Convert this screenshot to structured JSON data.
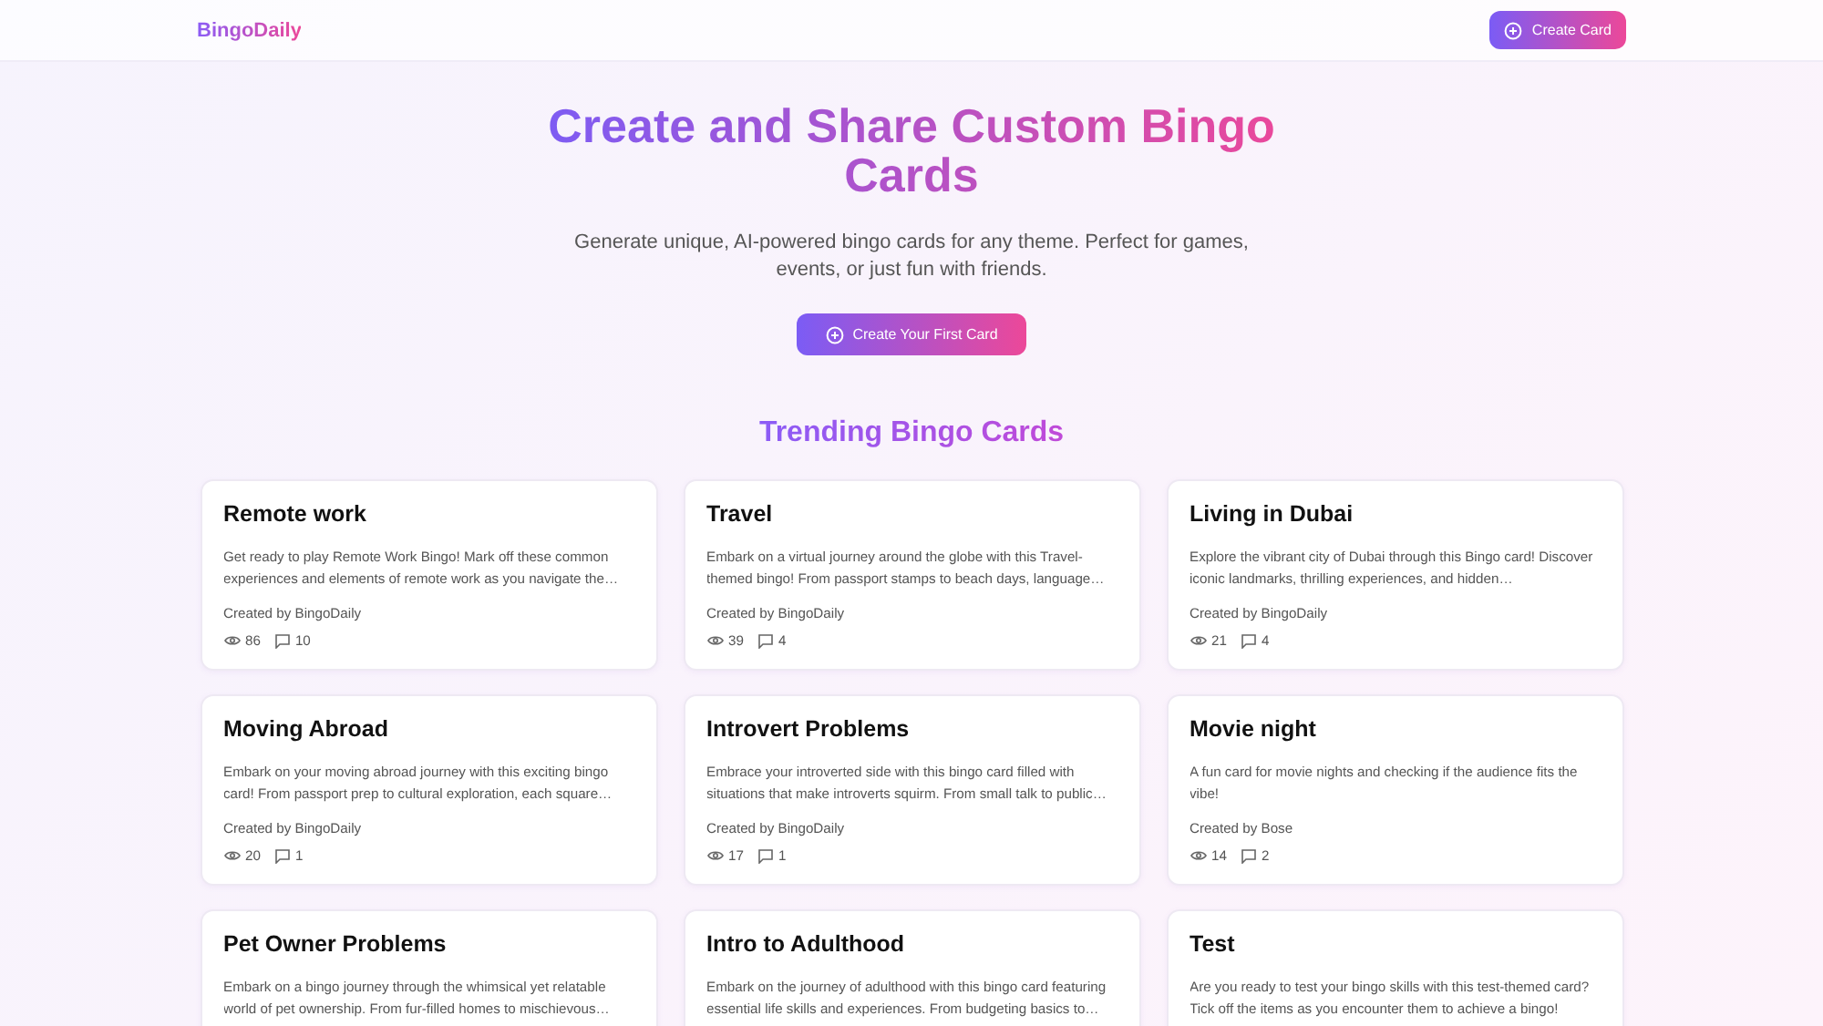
{
  "header": {
    "logo": "BingoDaily",
    "button": "Create Card"
  },
  "hero": {
    "title": "Create and Share Custom Bingo Cards",
    "subtitle": "Generate unique, AI-powered bingo cards for any theme. Perfect for games, events, or just fun with friends.",
    "button": "Create Your First Card"
  },
  "section_title": "Trending Bingo Cards",
  "cards": [
    {
      "title": "Remote work",
      "description": "Get ready to play Remote Work Bingo! Mark off these common experiences and elements of remote work as you navigate the…",
      "author": "Created by BingoDaily",
      "views": "86",
      "comments": "10"
    },
    {
      "title": "Travel",
      "description": "Embark on a virtual journey around the globe with this Travel-themed bingo! From passport stamps to beach days, language…",
      "author": "Created by BingoDaily",
      "views": "39",
      "comments": "4"
    },
    {
      "title": "Living in Dubai",
      "description": "Explore the vibrant city of Dubai through this Bingo card! Discover iconic landmarks, thrilling experiences, and hidden…",
      "author": "Created by BingoDaily",
      "views": "21",
      "comments": "4"
    },
    {
      "title": "Moving Abroad",
      "description": "Embark on your moving abroad journey with this exciting bingo card! From passport prep to cultural exploration, each square…",
      "author": "Created by BingoDaily",
      "views": "20",
      "comments": "1"
    },
    {
      "title": "Introvert Problems",
      "description": "Embrace your introverted side with this bingo card filled with situations that make introverts squirm. From small talk to public…",
      "author": "Created by BingoDaily",
      "views": "17",
      "comments": "1"
    },
    {
      "title": "Movie night",
      "description": "A fun card for movie nights and checking if the audience fits the vibe!",
      "author": "Created by Bose",
      "views": "14",
      "comments": "2"
    },
    {
      "title": "Pet Owner Problems",
      "description": "Embark on a bingo journey through the whimsical yet relatable world of pet ownership. From fur-filled homes to mischievous…"
    },
    {
      "title": "Intro to Adulthood",
      "description": "Embark on the journey of adulthood with this bingo card featuring essential life skills and experiences. From budgeting basics to…"
    },
    {
      "title": "Test",
      "description": "Are you ready to test your bingo skills with this test-themed card? Tick off the items as you encounter them to achieve a bingo!"
    }
  ]
}
